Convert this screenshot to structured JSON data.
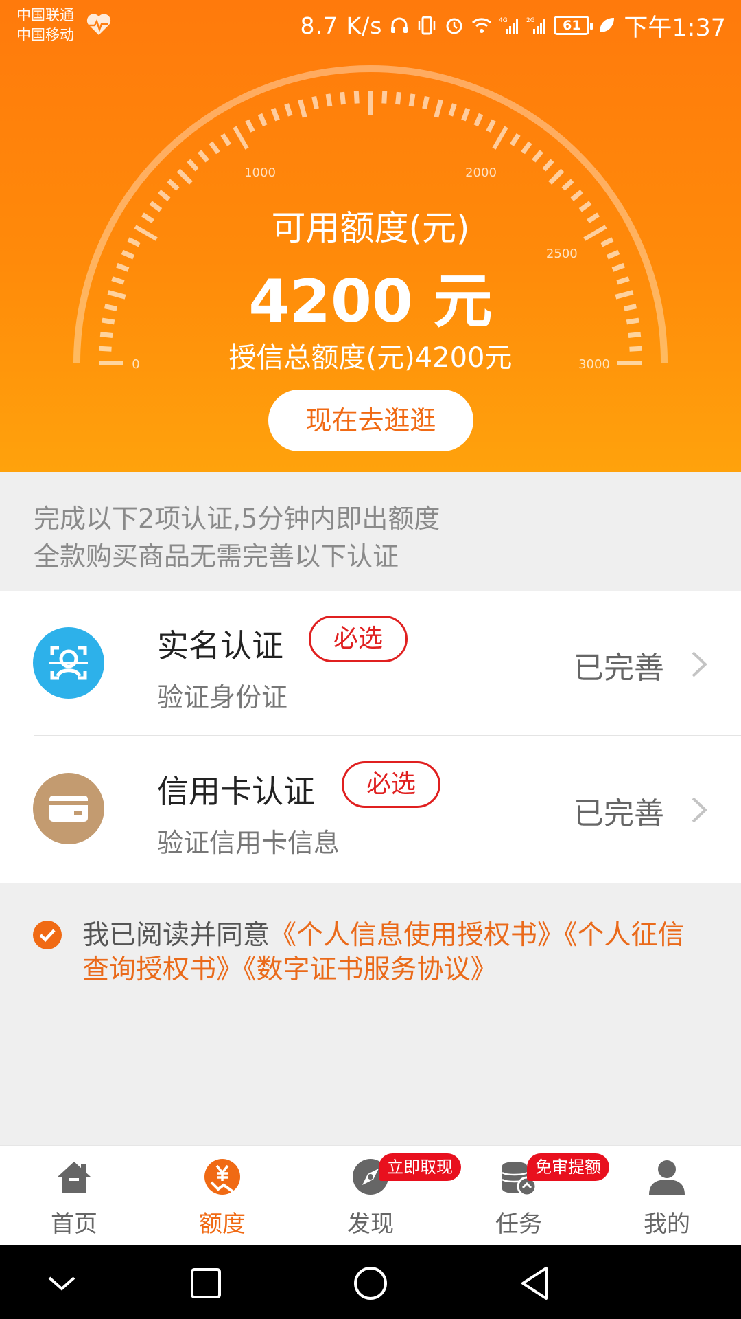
{
  "status_bar": {
    "carrier_1": "中国联通",
    "carrier_2": "中国移动",
    "speed": "8.7 K/s",
    "network_1": "4G",
    "network_2": "2G",
    "battery": "61",
    "time": "下午1:37"
  },
  "gauge": {
    "tick_labels": [
      "0",
      "1000",
      "2000",
      "2500",
      "3000"
    ]
  },
  "credit": {
    "title": "可用额度(元)",
    "amount": "4200 元",
    "total": "授信总额度(元)4200元",
    "button_label": "现在去逛逛"
  },
  "info": {
    "line1": "完成以下2项认证,5分钟内即出额度",
    "line2": "全款购买商品无需完善以下认证"
  },
  "certifications": [
    {
      "title": "实名认证",
      "badge": "必选",
      "subtitle": "验证身份证",
      "status": "已完善",
      "icon": "face-scan-icon"
    },
    {
      "title": "信用卡认证",
      "badge": "必选",
      "subtitle": "验证信用卡信息",
      "status": "已完善",
      "icon": "credit-card-icon"
    }
  ],
  "agreement": {
    "prefix": "我已阅读并同意",
    "link1": "《个人信息使用授权书》",
    "link2": "《个人征信查询授权书》",
    "link3": "《数字证书服务协议》",
    "checked": true
  },
  "tabs": [
    {
      "label": "首页",
      "icon": "home-icon",
      "active": false
    },
    {
      "label": "额度",
      "icon": "credit-icon",
      "active": true
    },
    {
      "label": "发现",
      "icon": "discover-icon",
      "active": false,
      "badge": "立即取现"
    },
    {
      "label": "任务",
      "icon": "task-icon",
      "active": false,
      "badge": "免审提额"
    },
    {
      "label": "我的",
      "icon": "profile-icon",
      "active": false
    }
  ],
  "colors": {
    "accent": "#f06a14",
    "header_top": "#ff7a0c",
    "header_bottom": "#ffa20c",
    "badge_red": "#e02020",
    "blue_icon": "#2db1ea",
    "brown_icon": "#c39b70"
  }
}
